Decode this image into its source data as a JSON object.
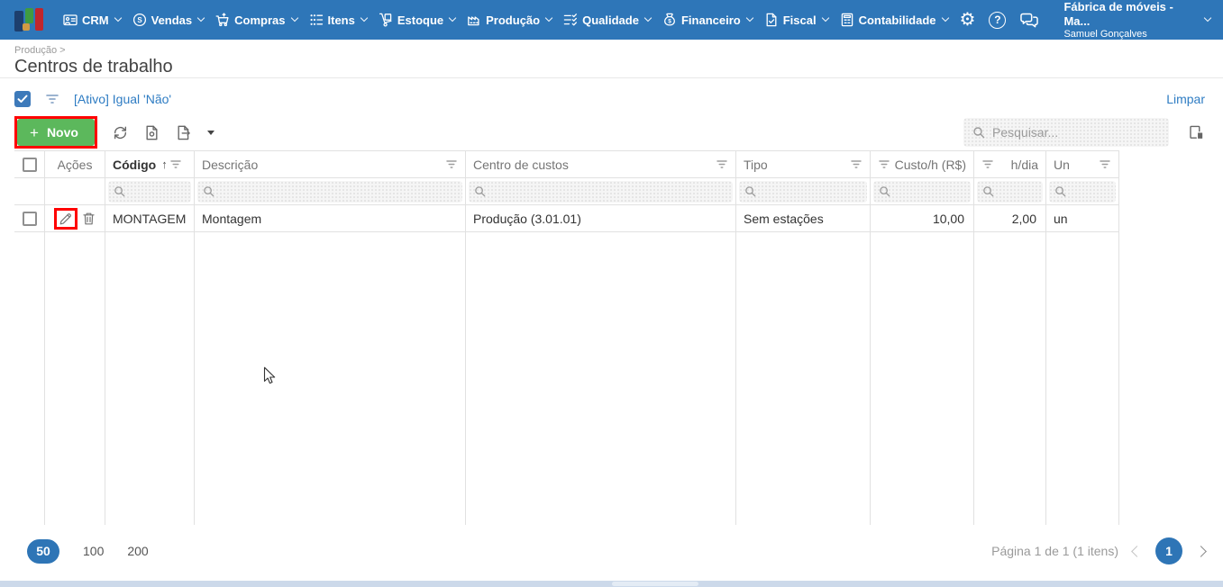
{
  "topbar": {
    "menus": [
      "CRM",
      "Vendas",
      "Compras",
      "Itens",
      "Estoque",
      "Produção",
      "Qualidade",
      "Financeiro",
      "Fiscal",
      "Contabilidade"
    ],
    "account": {
      "company": "Fábrica de móveis - Ma...",
      "user": "Samuel Gonçalves"
    }
  },
  "header": {
    "breadcrumb": "Produção >",
    "title": "Centros de trabalho"
  },
  "filter_bar": {
    "condition": "[Ativo] Igual 'Não'",
    "clear_label": "Limpar"
  },
  "toolbar": {
    "new_plus": "+",
    "new_label": "Novo",
    "search_placeholder": "Pesquisar..."
  },
  "grid": {
    "columns": {
      "acoes": "Ações",
      "codigo": "Código",
      "descricao": "Descrição",
      "centro": "Centro de custos",
      "tipo": "Tipo",
      "custo": "Custo/h (R$)",
      "hdia": "h/dia",
      "un": "Un"
    },
    "rows": [
      {
        "codigo": "MONTAGEM",
        "descricao": "Montagem",
        "centro": "Produção (3.01.01)",
        "tipo": "Sem estações",
        "custo": "10,00",
        "hdia": "2,00",
        "un": "un"
      }
    ]
  },
  "pager": {
    "sizes": [
      "50",
      "100",
      "200"
    ],
    "selected_size": "50",
    "info": "Página 1 de 1 (1 itens)",
    "current_page": "1"
  },
  "icons": {
    "gear": "⚙",
    "help": "?",
    "sort_ascending": "↑"
  },
  "colors": {
    "topbar_bg": "#2e76b8",
    "accent_blue": "#2e75b6",
    "link_blue": "#2e7cc3",
    "button_green": "#5cb85c",
    "annotation_red": "#ff0000",
    "grid_border": "#e1e1e1",
    "header_text": "#757575",
    "body_text": "#333333"
  }
}
